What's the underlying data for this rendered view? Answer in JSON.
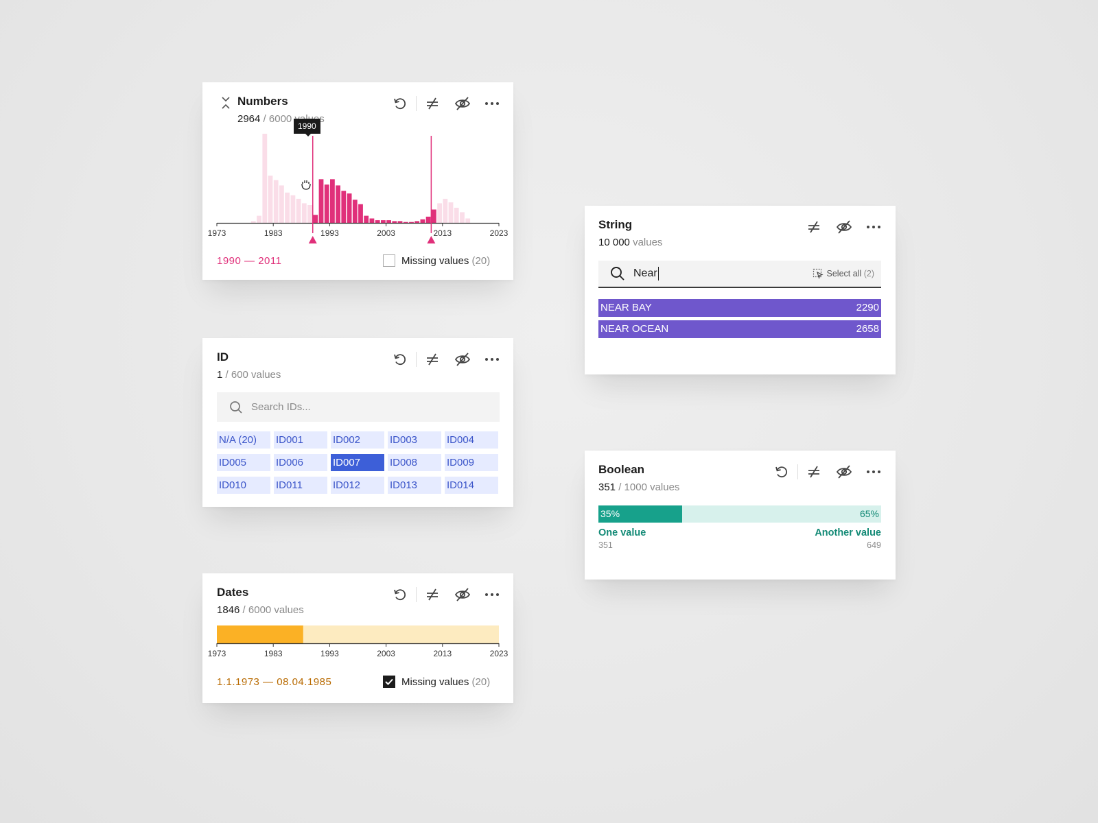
{
  "colors": {
    "numbers_accent": "#e0307a",
    "numbers_light": "#fadde8",
    "dates_fill": "#fbb125",
    "dates_light": "#fdebc0",
    "dates_text": "#b86a00",
    "id_cell_bg": "#e6ebff",
    "id_selected": "#3d5fd8",
    "string_bar": "#6f57cc",
    "bool_dark": "#17a18b",
    "bool_light": "#d7f1ec",
    "bool_text": "#138a76"
  },
  "icons": {
    "collapse": "chevrons-collapse-icon",
    "reset": "reset-icon",
    "filter": "not-equal-filter-icon",
    "hide": "eye-off-icon",
    "more": "more-dots-icon",
    "search": "search-icon",
    "select_all": "select-all-icon",
    "grab": "grab-hand-icon",
    "check": "check-icon"
  },
  "numbers": {
    "title": "Numbers",
    "count": "2964",
    "total": "/ 6000 values",
    "tooltip": "1990",
    "range_start": "1990",
    "range_sep": " — ",
    "range_end": "2011",
    "missing_label": "Missing values",
    "missing_count": "(20)",
    "missing_checked": false
  },
  "id": {
    "title": "ID",
    "count": "1",
    "total": "/ 600 values",
    "search_placeholder": "Search IDs...",
    "items": [
      "N/A (20)",
      "ID001",
      "ID002",
      "ID003",
      "ID004",
      "ID005",
      "ID006",
      "ID007",
      "ID008",
      "ID009",
      "ID010",
      "ID011",
      "ID012",
      "ID013",
      "ID014"
    ],
    "selected": "ID007"
  },
  "dates": {
    "title": "Dates",
    "count": "1846",
    "total": "/ 6000 values",
    "range_start": "1.1.1973",
    "range_sep": " — ",
    "range_end": "08.04.1985",
    "missing_label": "Missing values",
    "missing_count": "(20)",
    "missing_checked": true,
    "selected_fraction": 0.306
  },
  "string": {
    "title": "String",
    "count": "10 000",
    "total": "values",
    "search_value": "Near",
    "select_all_label": "Select all",
    "select_all_count": "(2)",
    "rows": [
      {
        "label": "NEAR BAY",
        "count": "2290"
      },
      {
        "label": "NEAR OCEAN",
        "count": "2658"
      }
    ]
  },
  "boolean": {
    "title": "Boolean",
    "count": "351",
    "total": "/ 1000 values",
    "left_pct": "35%",
    "right_pct": "65%",
    "left_fraction": 0.295,
    "left_label": "One value",
    "left_count": "351",
    "right_label": "Another value",
    "right_count": "649"
  },
  "chart_data": {
    "type": "bar",
    "xlabel": "",
    "ylabel": "",
    "xlim": [
      1973,
      2023
    ],
    "ticks": [
      "1973",
      "1983",
      "1993",
      "2003",
      "2013",
      "2023"
    ],
    "selected_range": [
      1990,
      2011
    ],
    "x": [
      1973,
      1974,
      1975,
      1976,
      1977,
      1978,
      1979,
      1980,
      1981,
      1982,
      1983,
      1984,
      1985,
      1986,
      1987,
      1988,
      1989,
      1990,
      1991,
      1992,
      1993,
      1994,
      1995,
      1996,
      1997,
      1998,
      1999,
      2000,
      2001,
      2002,
      2003,
      2004,
      2005,
      2006,
      2007,
      2008,
      2009,
      2010,
      2011,
      2012,
      2013,
      2014,
      2015,
      2016,
      2017,
      2018,
      2019,
      2020,
      2021,
      2022
    ],
    "values": [
      0,
      0,
      0,
      0,
      0,
      0,
      2,
      8,
      100,
      53,
      48,
      42,
      34,
      31,
      27,
      22,
      20,
      9,
      49,
      43,
      49,
      42,
      36,
      33,
      26,
      21,
      8,
      5,
      3,
      3,
      3,
      2,
      2,
      1,
      1,
      2,
      4,
      7,
      15,
      22,
      27,
      23,
      17,
      12,
      5,
      0,
      0,
      0,
      0,
      0
    ]
  }
}
